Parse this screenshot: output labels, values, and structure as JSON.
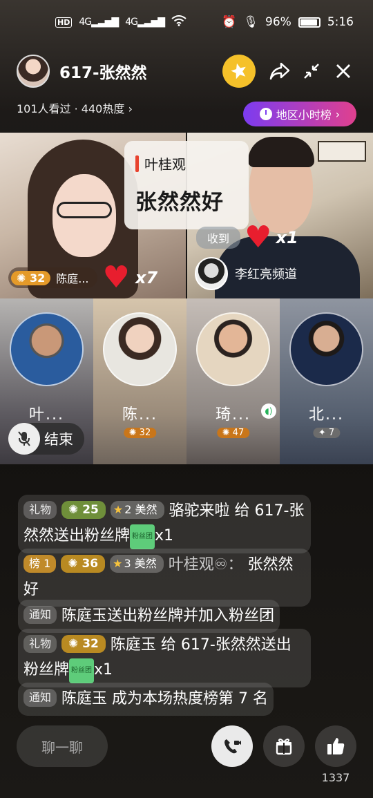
{
  "status_bar": {
    "hd": "HD",
    "sim": "2",
    "signal1": "4G",
    "signal2": "4G",
    "battery": "96%",
    "time": "5:16"
  },
  "header": {
    "room_title": "617-张然然",
    "viewers": "101人看过 · 440热度",
    "rank_button": "地区小时榜"
  },
  "video": {
    "message_card": {
      "name": "叶桂观",
      "text": "张然然好"
    },
    "left_gift": {
      "level": "32",
      "sender": "陈庭...",
      "count": "x7"
    },
    "right_gift": {
      "received": "收到",
      "count": "x1"
    },
    "channel": "李红亮频道"
  },
  "guests": [
    {
      "name": "叶...",
      "badge": ""
    },
    {
      "name": "陈...",
      "badge": "32"
    },
    {
      "name": "琦...",
      "badge": "47"
    },
    {
      "name": "北...",
      "badge": "7"
    }
  ],
  "end_button": "结束",
  "chat": [
    {
      "tag": "礼物",
      "level": "25",
      "fan_level": "2",
      "fan_name": "美然",
      "text": "骆驼来啦 给 617-张然然送出粉丝牌",
      "suffix": "x1",
      "fan_badge": "粉丝团"
    },
    {
      "tag": "榜 1",
      "level": "36",
      "fan_level": "3",
      "fan_name": "美然",
      "name": "叶桂观♾：",
      "text": "张然然好"
    },
    {
      "tag": "通知",
      "text": "陈庭玉送出粉丝牌并加入粉丝团"
    },
    {
      "tag": "礼物",
      "level": "32",
      "text": "陈庭玉 给 617-张然然送出粉丝牌",
      "suffix": "x1",
      "fan_badge": "粉丝团"
    },
    {
      "tag": "通知",
      "text": "陈庭玉 成为本场热度榜第 7 名"
    }
  ],
  "bottom": {
    "chat_placeholder": "聊一聊",
    "like_count": "1337"
  }
}
